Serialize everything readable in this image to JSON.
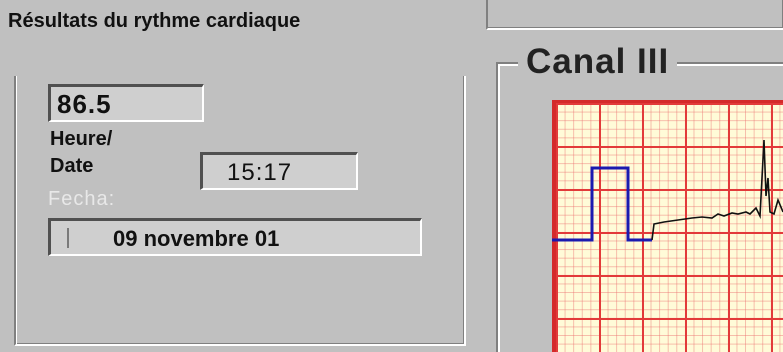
{
  "heart_rate_results": {
    "title": "Résultats du rythme cardiaque",
    "rate_value": "86.5",
    "time_date_label_line1": "Heure/",
    "time_date_label_line2": "Date",
    "obscured_label": "Fecha:",
    "time_value": "15:17",
    "date_value": "09 novembre 01"
  },
  "channel": {
    "title": "Canal III",
    "paper_color": "#fffbd8",
    "grid_color": "#e23a3a",
    "calibration_pulse_color": "#1a1ab0",
    "trace_color": "#111111"
  }
}
